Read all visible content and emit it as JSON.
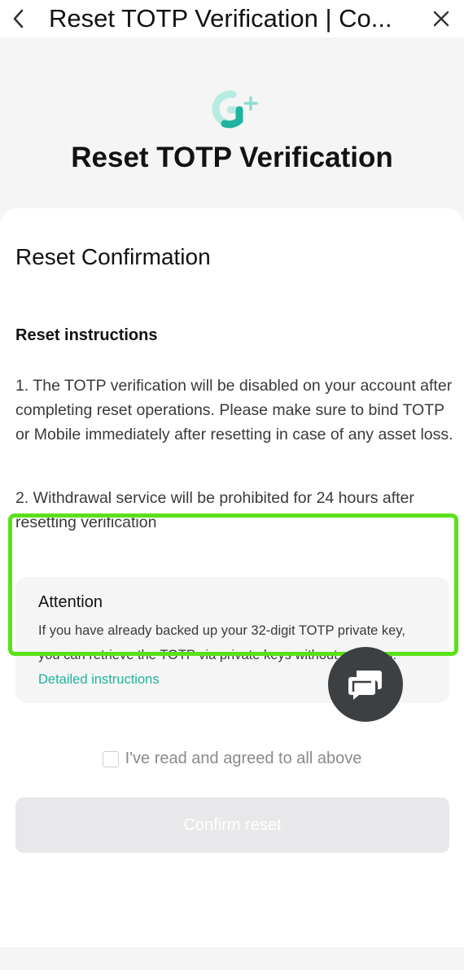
{
  "topbar": {
    "title": "Reset TOTP Verification | Co...",
    "back_icon": "chevron-left-icon",
    "close_icon": "close-icon"
  },
  "hero": {
    "logo_icon": "g-plus-logo-icon",
    "heading": "Reset TOTP Verification"
  },
  "card": {
    "section_title": "Reset Confirmation",
    "instructions_title": "Reset instructions",
    "instructions": [
      "1. The TOTP verification will be disabled on your account after completing reset operations. Please make sure to bind TOTP or Mobile immediately after resetting in case of any asset loss.",
      "2. Withdrawal service will be prohibited for 24 hours after resetting verification"
    ],
    "attention": {
      "title": "Attention",
      "body": "If you have already backed up your 32-digit TOTP private key, you can retrieve the TOTP via private keys without resetting. ",
      "link": "Detailed instructions"
    },
    "agree_label": "I've read and agreed to all above",
    "agree_checked": false,
    "confirm_label": "Confirm reset"
  },
  "colors": {
    "accent": "#1fb3a0",
    "highlight": "#5be01a",
    "fab": "#3d4043"
  },
  "fab_icon": "chat-bubble-icon"
}
